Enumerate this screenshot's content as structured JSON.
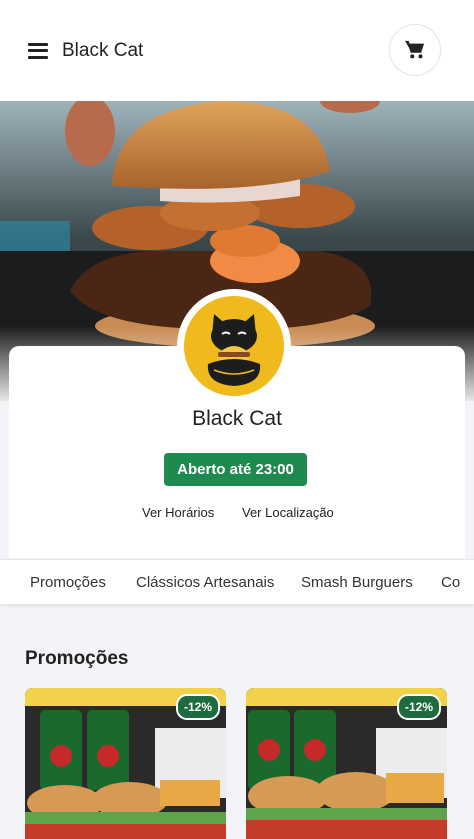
{
  "header": {
    "title": "Black Cat",
    "menu_icon": "menu-icon",
    "cart_icon": "cart-icon"
  },
  "store": {
    "name": "Black Cat",
    "status": "Aberto até 23:00",
    "status_color": "#1e8a50",
    "links": {
      "hours": "Ver Horários",
      "location": "Ver Localização"
    },
    "logo_color": "#f0b91c"
  },
  "tabs": [
    "Promoções",
    "Clássicos Artesanais",
    "Smash Burguers",
    "Co"
  ],
  "section": {
    "title": "Promoções"
  },
  "products": [
    {
      "discount": "-12%"
    },
    {
      "discount": "-12%"
    }
  ]
}
